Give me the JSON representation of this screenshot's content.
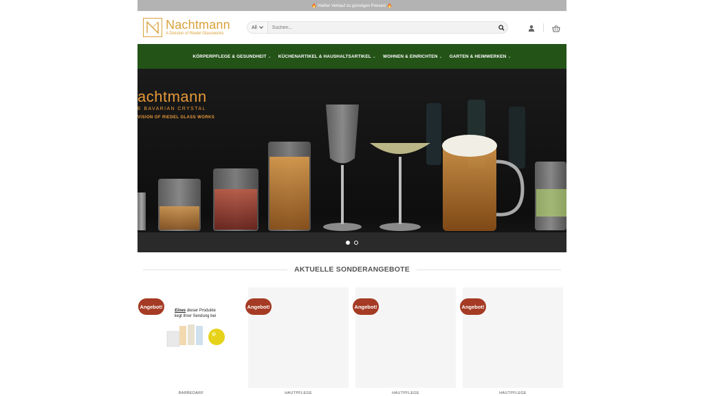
{
  "topbar": {
    "text": "🔥 Heißer Verkauf zu günstigen Preisen! 🔥"
  },
  "logo": {
    "title": "Nachtmann",
    "subtitle": "A Division of Riedel Glassworks"
  },
  "search": {
    "category": "All",
    "placeholder": "Suchen..."
  },
  "header_icons": [
    "user-icon",
    "cart-icon"
  ],
  "nav": {
    "items": [
      {
        "label": "KÖRPERPFLEGE & GESUNDHEIT"
      },
      {
        "label": "KÜCHENARTIKEL & HAUSHALTSARTIKEL"
      },
      {
        "label": "WOHNEN & EINRICHTEN"
      },
      {
        "label": "GARTEN & HEIMWERKEN"
      }
    ]
  },
  "hero": {
    "line1": "achtmann",
    "line2": "E BAVARIAN CRYSTAL",
    "line3": "VISION OF RIEDEL GLASS WORKS",
    "slides": 2,
    "active_slide": 1
  },
  "section": {
    "title": "AKTUELLE SONDERANGEBOTE"
  },
  "products": [
    {
      "badge": "Angebot!",
      "category": "BARBEDARF",
      "note_em": "Eines",
      "note_rest": " dieser Produkte",
      "note_line2": "liegt Ihrer Sendung bei"
    },
    {
      "badge": "Angebot!",
      "category": "HAUTPFLEGE"
    },
    {
      "badge": "Angebot!",
      "category": "HAUTPFLEGE"
    },
    {
      "badge": "Angebot!",
      "category": "HAUTPFLEGE"
    }
  ],
  "colors": {
    "nav_bg": "#245318",
    "brand": "#d9a13a",
    "badge": "#a53b24",
    "topbar": "#b3b3b3"
  }
}
